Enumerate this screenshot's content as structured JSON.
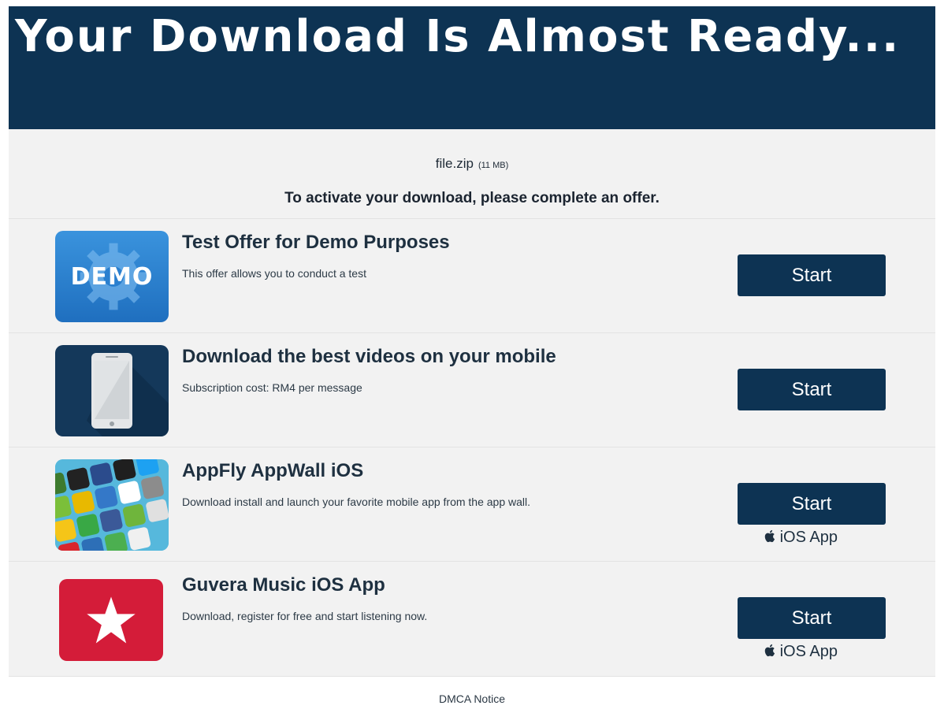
{
  "header": {
    "title": "Your Download Is Almost Ready..."
  },
  "file": {
    "name": "file.zip",
    "size": "(11 MB)"
  },
  "instruction": "To activate your download, please complete an offer.",
  "offers": [
    {
      "title": "Test Offer for Demo Purposes",
      "description": "This offer allows you to conduct a test",
      "button": "Start",
      "thumb_text": "DEMO",
      "badge": ""
    },
    {
      "title": "Download the best videos on your mobile",
      "description": "Subscription cost: RM4 per message",
      "button": "Start",
      "badge": ""
    },
    {
      "title": "AppFly AppWall iOS",
      "description": "Download install and launch your favorite mobile app from the app wall.",
      "button": "Start",
      "badge": "iOS App"
    },
    {
      "title": "Guvera Music iOS App",
      "description": "Download, register for free and start listening now.",
      "button": "Start",
      "badge": "iOS App"
    }
  ],
  "footer": {
    "link": "DMCA Notice"
  },
  "colors": {
    "header_bg": "#0d3353",
    "button_bg": "#0d3353",
    "page_bg": "#f2f2f2",
    "guvera_red": "#d41c39"
  }
}
